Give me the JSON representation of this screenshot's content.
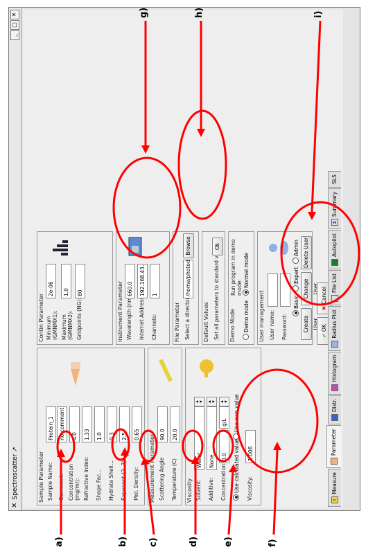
{
  "window": {
    "title": "Spectroscatter",
    "title_suffix": "↗"
  },
  "sample": {
    "title": "Sample Parameter",
    "name_label": "Sample Name:",
    "name_value": "Protein_1",
    "comment_label": "Comment:",
    "comment_value": "no comment",
    "concentration_label": "Concentration\n(mg/ml):",
    "concentration_value": "4.0",
    "refractive_label": "Refractive Index:",
    "refractive_value": "1.33",
    "shape_label": "Shape Fac...",
    "shape_value": "1.0",
    "hydrate_label": "Hydrate Shell...",
    "hydrate_value": "0.3",
    "exponent_label": "Exponent (2..3):",
    "exponent_value": "2.5",
    "density_label": "Mol. Density:",
    "density_value": "0.65"
  },
  "measurement": {
    "title": "Measurement Parameter",
    "angle_label": "Scattering Angle",
    "angle_value": "90.0",
    "temp_label": "Temperature (C)",
    "temp_value": "20.0"
  },
  "viscosity": {
    "title": "Viscosity",
    "solvent_label": "Solvent:",
    "solvent_value": "Water",
    "additive_label": "Additive:",
    "additive_value": "None",
    "conc_label": "Concentration:",
    "conc_value": "0.0",
    "conc_unit": "g/L",
    "radio_calc": "Use calculated value",
    "radio_own": "Use own value",
    "visc_label": "Viscosity:",
    "visc_value": "1.006"
  },
  "contin": {
    "title": "Contin Parameter",
    "min_label": "Minimum\n(GMNMX1):",
    "min_value": "2e-06",
    "max_label": "Maximum\n(GMNMX2):",
    "max_value": "1.0",
    "grid_label": "Gridpoints (NG):",
    "grid_value": "80"
  },
  "instrument": {
    "title": "Instrument Parameter",
    "wave_label": "Wavelength (nm):",
    "wave_value": "660.0",
    "ip_label": "Internet Address:",
    "ip_value": "192.168.43.88",
    "ch_label": "Channels:",
    "ch_value": "1"
  },
  "file": {
    "title": "File Parameter",
    "dir_label": "Select a directory:",
    "dir_value": "/home/photodata",
    "browse": "Browse"
  },
  "defaults": {
    "title": "Default Values",
    "text": "Set all parameters to standard values:",
    "ok": "Ok"
  },
  "demo": {
    "title": "Demo Mode",
    "run_text": "Run program in demo mode:",
    "demo_mode": "Demo mode",
    "normal_mode": "Normal mode"
  },
  "user": {
    "title": "User management",
    "user_label": "User name:",
    "pass_label": "Password:",
    "basic": "Basic",
    "expert": "Expert",
    "admin": "Admin",
    "create": "Create User",
    "change": "Change User",
    "delete": "Delete User"
  },
  "actions": {
    "ok": "OK",
    "cancel": "Cancel"
  },
  "tabs": [
    "Measure",
    "Parameter",
    "Distr.",
    "Histogram",
    "Radius Plot",
    "File List",
    "Autopilot",
    "Summary",
    "SLS"
  ],
  "annotations": [
    "a)",
    "b)",
    "c)",
    "d)",
    "e)",
    "f)",
    "g)",
    "h)",
    "i)"
  ],
  "colors": {
    "annotation": "#ff0000",
    "window_bg": "#e4e4e4",
    "ok_check": "#2f9a2f",
    "cancel_x": "#d02020"
  }
}
